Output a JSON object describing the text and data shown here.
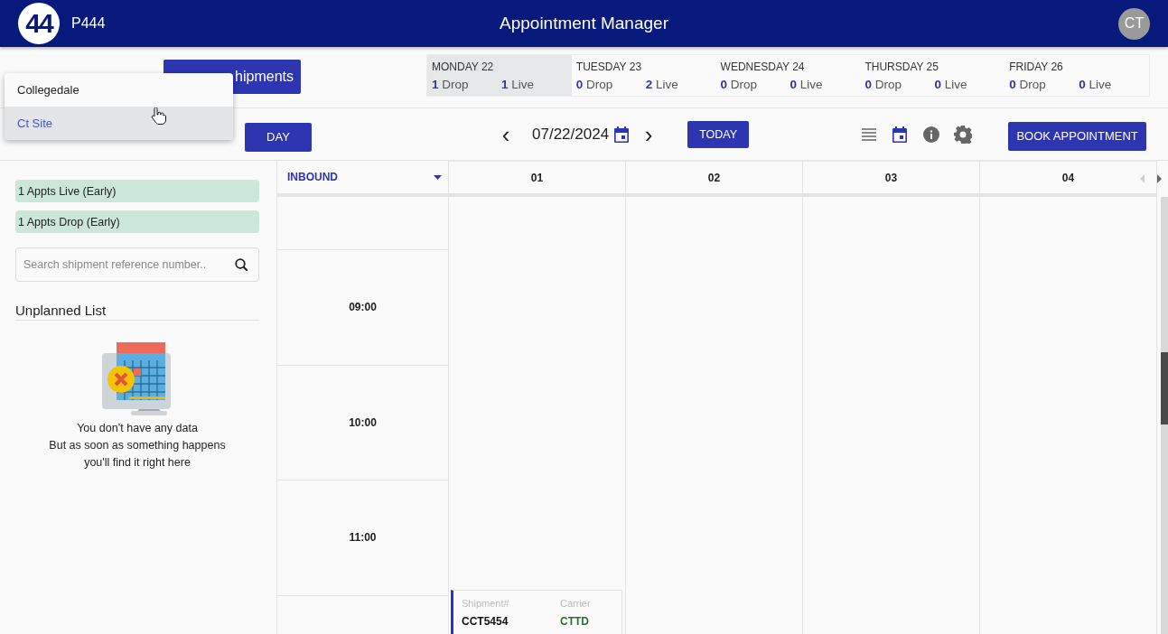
{
  "header": {
    "logo": "44",
    "site_code": "P444",
    "title": "Appointment Manager",
    "avatar": "CT"
  },
  "booked_tab": {
    "label": "hipments"
  },
  "days": [
    {
      "day": "MONDAY 22",
      "drop_count": "1",
      "drop_label": "Drop",
      "live_count": "1",
      "live_label": "Live",
      "selected": true
    },
    {
      "day": "TUESDAY 23",
      "drop_count": "0",
      "drop_label": "Drop",
      "live_count": "2",
      "live_label": "Live",
      "selected": false
    },
    {
      "day": "WEDNESDAY 24",
      "drop_count": "0",
      "drop_label": "Drop",
      "live_count": "0",
      "live_label": "Live",
      "selected": false
    },
    {
      "day": "THURSDAY 25",
      "drop_count": "0",
      "drop_label": "Drop",
      "live_count": "0",
      "live_label": "Live",
      "selected": false
    },
    {
      "day": "FRIDAY 26",
      "drop_count": "0",
      "drop_label": "Drop",
      "live_count": "0",
      "live_label": "Live",
      "selected": false
    }
  ],
  "toolbar": {
    "view": "DAY",
    "prev": "‹",
    "date": "07/22/2024",
    "next": "›",
    "today": "TODAY",
    "views": [
      {
        "kind": "list",
        "selected": false
      },
      {
        "kind": "calendar",
        "selected": true
      }
    ],
    "book": "BOOK APPOINTMENT"
  },
  "site_menu": {
    "items": [
      {
        "label": "Collegedale",
        "selected": false
      },
      {
        "label": "Ct Site",
        "selected": true
      }
    ]
  },
  "summary_chips": [
    "1 Appts Live (Early)",
    "1 Appts Drop (Early)"
  ],
  "search": {
    "placeholder": "Search shipment reference number.."
  },
  "unplanned": {
    "title": "Unplanned List",
    "empty_lines": [
      "You don’t have any data",
      "But as soon as something happens",
      "you'll find it right here"
    ]
  },
  "schedule": {
    "direction": "INBOUND",
    "times": [
      "09:00",
      "10:00",
      "11:00"
    ],
    "docks": [
      {
        "label": "01",
        "appointments": [
          {
            "shipment_label": "Shipment#",
            "shipment": "CCT5454",
            "carrier_label": "Carrier",
            "carrier": "CTTD"
          }
        ]
      },
      {
        "label": "02"
      },
      {
        "label": "03"
      },
      {
        "label": "04"
      }
    ]
  }
}
